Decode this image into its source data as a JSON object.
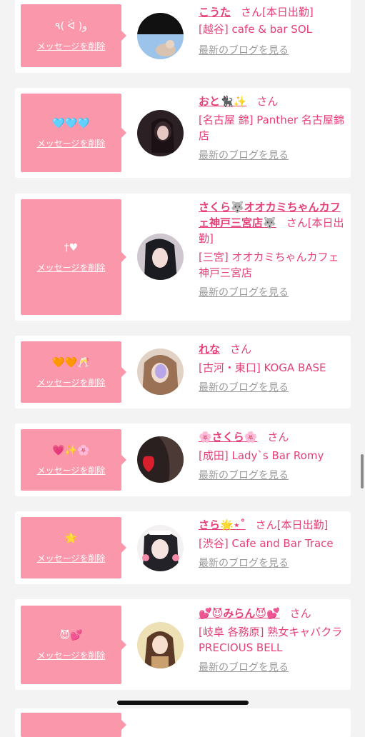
{
  "delete_label": "メッセージを削除",
  "blog_label": "最新のブログを見る",
  "san_label": "さん",
  "colors": {
    "accent": "#e5407a",
    "message_bg": "#fb97aa",
    "muted": "#9a9a9a"
  },
  "entries": [
    {
      "message": "٩( ᐛ )و",
      "name": "こうた",
      "badge": "[本日出勤]",
      "shop": "[越谷] cafe & bar SOL",
      "avatar": "avatar-sky"
    },
    {
      "message": "🩵🩵🩵",
      "name": "おと🐈‍⬛✨",
      "badge": "",
      "shop": "[名古屋 錦] Panther 名古屋錦店",
      "avatar": "avatar-girl-dark"
    },
    {
      "message": "†♥",
      "name": "さくら🐺オオカミちゃんカフェ神戸三宮店🐺",
      "badge": "[本日出勤]",
      "shop": "[三宮] オオカミちゃんカフェ神戸三宮店",
      "avatar": "avatar-girl-selfie"
    },
    {
      "message": "🧡🧡🥂",
      "name": "れな",
      "badge": "",
      "shop": "[古河・東口] KOGA BASE",
      "avatar": "avatar-girl-blur"
    },
    {
      "message": "💗✨🌸",
      "name": "🌸さくら🌸",
      "badge": "",
      "shop": "[成田] Lady`s Bar Romy",
      "avatar": "avatar-heart-hair"
    },
    {
      "message": "🌟",
      "name": "さら🌟⋆˚",
      "badge": "[本日出勤]",
      "shop": "[渋谷] Cafe and Bar Trace",
      "avatar": "avatar-girl-maid"
    },
    {
      "message": "😈💕",
      "name": "💕😈みらん😈💕",
      "badge": "",
      "shop": "[岐阜 各務原] 熟女キャバクラ PRECIOUS BELL",
      "avatar": "avatar-anime-girl"
    }
  ]
}
